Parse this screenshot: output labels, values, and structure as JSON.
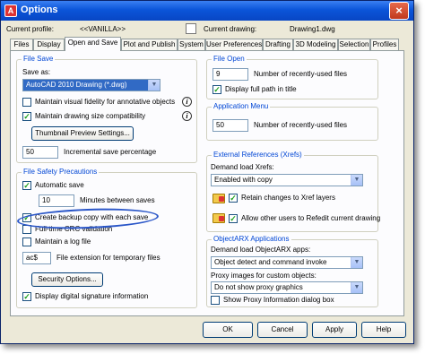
{
  "window": {
    "title": "Options",
    "close_glyph": "×"
  },
  "profile": {
    "label": "Current profile:",
    "value": "<<VANILLA>>",
    "drawing_label": "Current drawing:",
    "drawing_value": "Drawing1.dwg"
  },
  "tabs": [
    "Files",
    "Display",
    "Open and Save",
    "Plot and Publish",
    "System",
    "User Preferences",
    "Drafting",
    "3D Modeling",
    "Selection",
    "Profiles"
  ],
  "active_tab": "Open and Save",
  "file_save": {
    "title": "File Save",
    "save_as_label": "Save as:",
    "save_as_value": "AutoCAD 2010 Drawing (*.dwg)",
    "maintain_fidelity": "Maintain visual fidelity for annotative objects",
    "maintain_fidelity_checked": false,
    "maintain_size": "Maintain drawing size compatibility",
    "maintain_size_checked": true,
    "thumbnail_button": "Thumbnail Preview Settings...",
    "incremental_value": "50",
    "incremental_label": "Incremental save percentage"
  },
  "file_safety": {
    "title": "File Safety Precautions",
    "autosave": "Automatic save",
    "autosave_checked": true,
    "minutes_value": "10",
    "minutes_label": "Minutes between saves",
    "backup": "Create backup copy with each save",
    "backup_checked": true,
    "crc": "Full-time CRC validation",
    "crc_checked": false,
    "logfile": "Maintain a log file",
    "logfile_checked": false,
    "ext_value": "ac$",
    "ext_label": "File extension for temporary files",
    "security_button": "Security Options...",
    "signature": "Display digital signature information",
    "signature_checked": true
  },
  "file_open": {
    "title": "File Open",
    "recent_value": "9",
    "recent_label": "Number of recently-used files",
    "fullpath": "Display full path in title",
    "fullpath_checked": true
  },
  "app_menu": {
    "title": "Application Menu",
    "recent_value": "50",
    "recent_label": "Number of recently-used files"
  },
  "xrefs": {
    "title": "External References (Xrefs)",
    "demand_label": "Demand load Xrefs:",
    "demand_value": "Enabled with copy",
    "retain": "Retain changes to Xref layers",
    "retain_checked": true,
    "allow": "Allow other users to Refedit current drawing",
    "allow_checked": true
  },
  "objectarx": {
    "title": "ObjectARX Applications",
    "demand_label": "Demand load ObjectARX apps:",
    "demand_value": "Object detect and command invoke",
    "proxy_label": "Proxy images for custom objects:",
    "proxy_value": "Do not show proxy graphics",
    "show_proxy": "Show Proxy Information dialog box",
    "show_proxy_checked": false
  },
  "buttons": {
    "ok": "OK",
    "cancel": "Cancel",
    "apply": "Apply",
    "help": "Help"
  },
  "check_glyph": "✓",
  "info_glyph": "i"
}
